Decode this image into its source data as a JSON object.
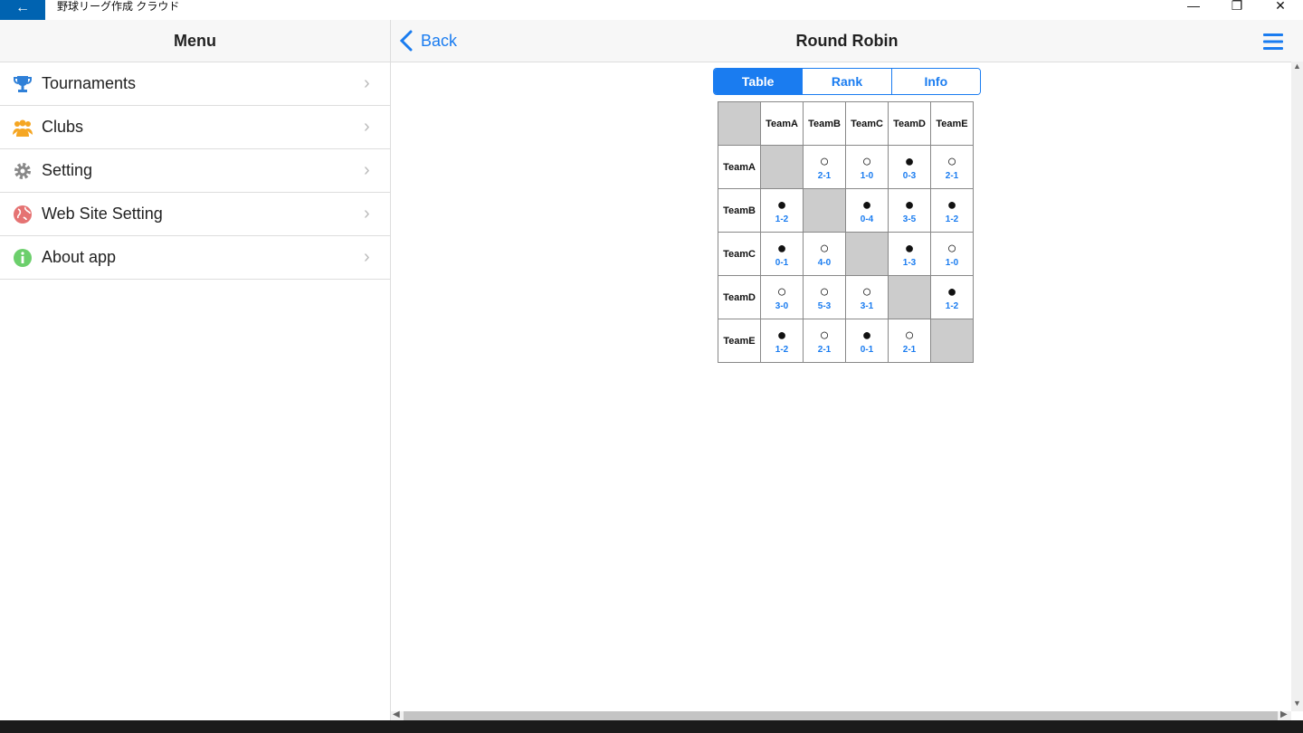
{
  "window": {
    "title": "野球リーグ作成 クラウド",
    "back_glyph": "←",
    "minimize_glyph": "—",
    "maximize_glyph": "❐",
    "close_glyph": "✕"
  },
  "sidebar": {
    "title": "Menu",
    "items": [
      {
        "label": "Tournaments",
        "icon": "trophy-icon",
        "color": "#2f80d8"
      },
      {
        "label": "Clubs",
        "icon": "group-icon",
        "color": "#f5a623"
      },
      {
        "label": "Setting",
        "icon": "gear-icon",
        "color": "#888888"
      },
      {
        "label": "Web Site Setting",
        "icon": "globe-icon",
        "color": "#e57373"
      },
      {
        "label": "About app",
        "icon": "info-icon",
        "color": "#6ccf6c"
      }
    ],
    "chevron": "›"
  },
  "header": {
    "back_label": "Back",
    "title": "Round Robin"
  },
  "tabs": [
    {
      "label": "Table",
      "active": true
    },
    {
      "label": "Rank",
      "active": false
    },
    {
      "label": "Info",
      "active": false
    }
  ],
  "table": {
    "teams": [
      "TeamA",
      "TeamB",
      "TeamC",
      "TeamD",
      "TeamE"
    ],
    "symbols": {
      "win": "○",
      "loss": "●"
    },
    "results": [
      [
        null,
        {
          "r": "win",
          "s": "2-1"
        },
        {
          "r": "win",
          "s": "1-0"
        },
        {
          "r": "loss",
          "s": "0-3"
        },
        {
          "r": "win",
          "s": "2-1"
        }
      ],
      [
        {
          "r": "loss",
          "s": "1-2"
        },
        null,
        {
          "r": "loss",
          "s": "0-4"
        },
        {
          "r": "loss",
          "s": "3-5"
        },
        {
          "r": "loss",
          "s": "1-2"
        }
      ],
      [
        {
          "r": "loss",
          "s": "0-1"
        },
        {
          "r": "win",
          "s": "4-0"
        },
        null,
        {
          "r": "loss",
          "s": "1-3"
        },
        {
          "r": "win",
          "s": "1-0"
        }
      ],
      [
        {
          "r": "win",
          "s": "3-0"
        },
        {
          "r": "win",
          "s": "5-3"
        },
        {
          "r": "win",
          "s": "3-1"
        },
        null,
        {
          "r": "loss",
          "s": "1-2"
        }
      ],
      [
        {
          "r": "loss",
          "s": "1-2"
        },
        {
          "r": "win",
          "s": "2-1"
        },
        {
          "r": "loss",
          "s": "0-1"
        },
        {
          "r": "win",
          "s": "2-1"
        },
        null
      ]
    ]
  },
  "colors": {
    "accent": "#1a7cf0",
    "titlebar_back": "#0063b1"
  }
}
